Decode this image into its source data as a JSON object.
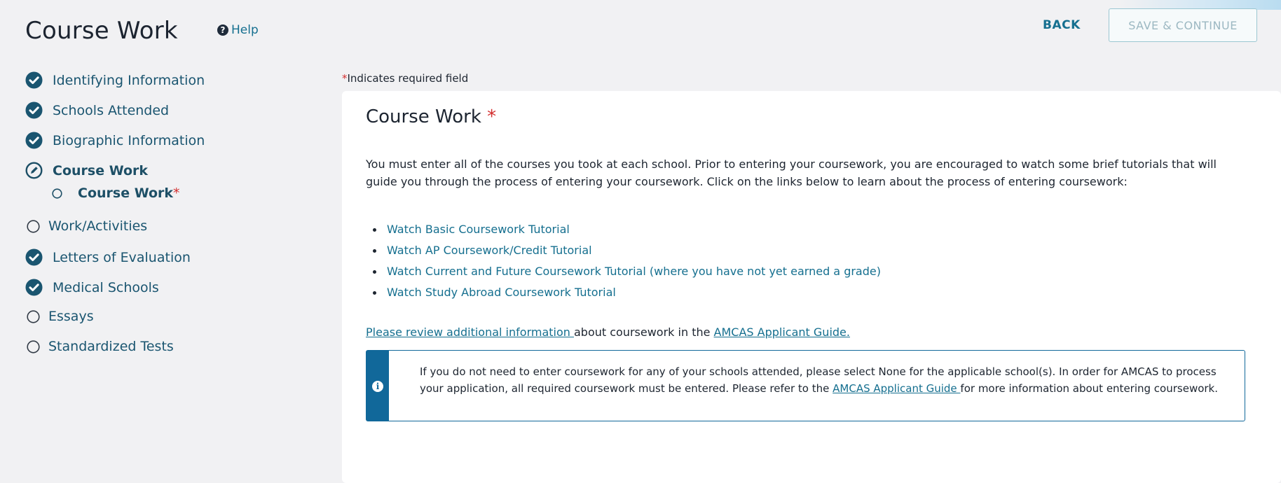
{
  "header": {
    "title": "Course Work",
    "help_label": "Help",
    "back_label": "BACK",
    "save_label": "SAVE & CONTINUE"
  },
  "sidebar": {
    "items": [
      {
        "label": "Identifying Information",
        "status": "complete"
      },
      {
        "label": "Schools Attended",
        "status": "complete"
      },
      {
        "label": "Biographic Information",
        "status": "complete"
      },
      {
        "label": "Course Work",
        "status": "in-progress"
      },
      {
        "label": "Course Work",
        "status": "current-sub",
        "required_mark": "*"
      },
      {
        "label": "Work/Activities",
        "status": "not-started"
      },
      {
        "label": "Letters of Evaluation",
        "status": "complete"
      },
      {
        "label": "Medical Schools",
        "status": "complete"
      },
      {
        "label": "Essays",
        "status": "not-started"
      },
      {
        "label": "Standardized Tests",
        "status": "not-started"
      }
    ]
  },
  "main": {
    "required_mark": "*",
    "required_note": "Indicates required field",
    "card_title": "Course Work",
    "intro": "You must enter all of the courses you took at each school. Prior to entering your coursework, you are encouraged to watch some brief tutorials that will guide you through the process of entering your coursework. Click on the links below to learn about the process of entering coursework:",
    "tutorials": [
      "Watch Basic Coursework Tutorial",
      "Watch AP Coursework/Credit Tutorial",
      "Watch Current and Future Coursework Tutorial (where you have not yet earned a grade)",
      "Watch Study Abroad Coursework Tutorial"
    ],
    "review": {
      "link": "Please review additional information ",
      "middle": "about coursework in the ",
      "guide_link": "AMCAS Applicant Guide."
    },
    "info": {
      "text_before": "If you do not need to enter coursework for any of your schools attended, please select None for the applicable school(s). In order for AMCAS to process your application, all required coursework must be entered. Please refer to the ",
      "link": "AMCAS Applicant Guide ",
      "text_after": "for more information about entering coursework."
    }
  },
  "colors": {
    "brand_teal": "#156f8f",
    "nav_text": "#1a5570",
    "info_blue": "#11689a",
    "required_red": "#d32f2f"
  }
}
